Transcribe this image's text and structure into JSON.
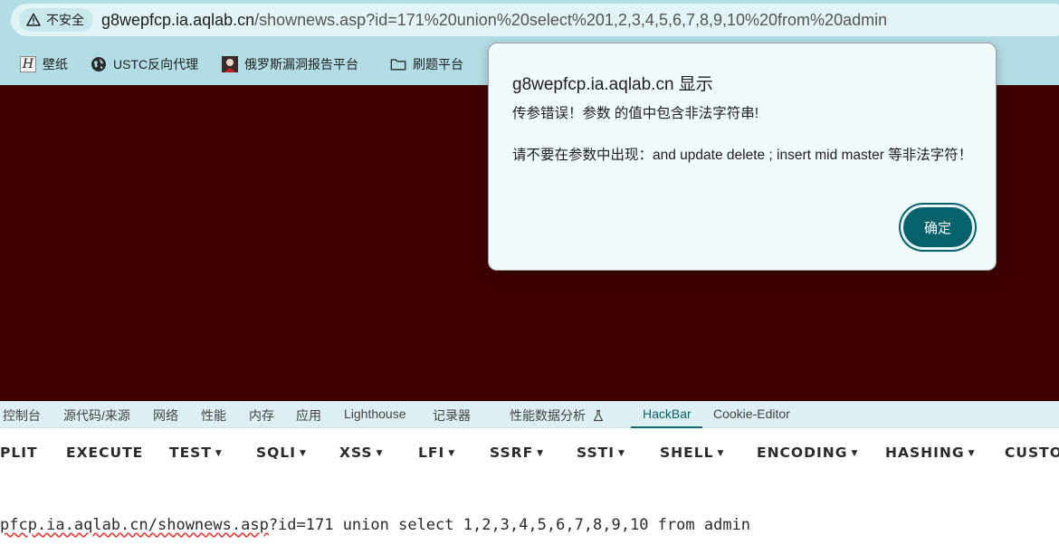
{
  "address_bar": {
    "security_label": "不安全",
    "url_host": "g8wepfcp.ia.aqlab.cn",
    "url_path": "/shownews.asp?id=171%20union%20select%201,2,3,4,5,6,7,8,9,10%20from%20admin"
  },
  "bookmarks": [
    {
      "label": "壁纸",
      "icon": "h-logo-icon"
    },
    {
      "label": "USTC反向代理",
      "icon": "globe-icon"
    },
    {
      "label": "俄罗斯漏洞报告平台",
      "icon": "avatar-icon"
    },
    {
      "label": "刷题平台",
      "icon": "folder-icon"
    }
  ],
  "dialog": {
    "title": "g8wepfcp.ia.aqlab.cn 显示",
    "message_line1": "传参错误！参数 的值中包含非法字符串!",
    "message_line2": "请不要在参数中出现：and update delete ; insert mid master 等非法字符！",
    "ok_label": "确定"
  },
  "devtools": {
    "tabs": [
      "控制台",
      "源代码/来源",
      "网络",
      "性能",
      "内存",
      "应用",
      "Lighthouse",
      "记录器",
      "性能数据分析",
      "HackBar",
      "Cookie-Editor"
    ],
    "active_tab": "HackBar"
  },
  "hackbar": {
    "buttons": [
      "PLIT",
      "EXECUTE",
      "TEST",
      "SQLI",
      "XSS",
      "LFI",
      "SSRF",
      "SSTI",
      "SHELL",
      "ENCODING",
      "HASHING",
      "CUSTOM"
    ],
    "url_spell_part": "pfcp.ia.aqlab.cn/shownews.asp",
    "url_rest": "?id=171 union select 1,2,3,4,5,6,7,8,9,10 from admin"
  },
  "colors": {
    "chrome_bg": "#b3dde4",
    "page_bg": "#400000",
    "accent": "#05616b"
  }
}
